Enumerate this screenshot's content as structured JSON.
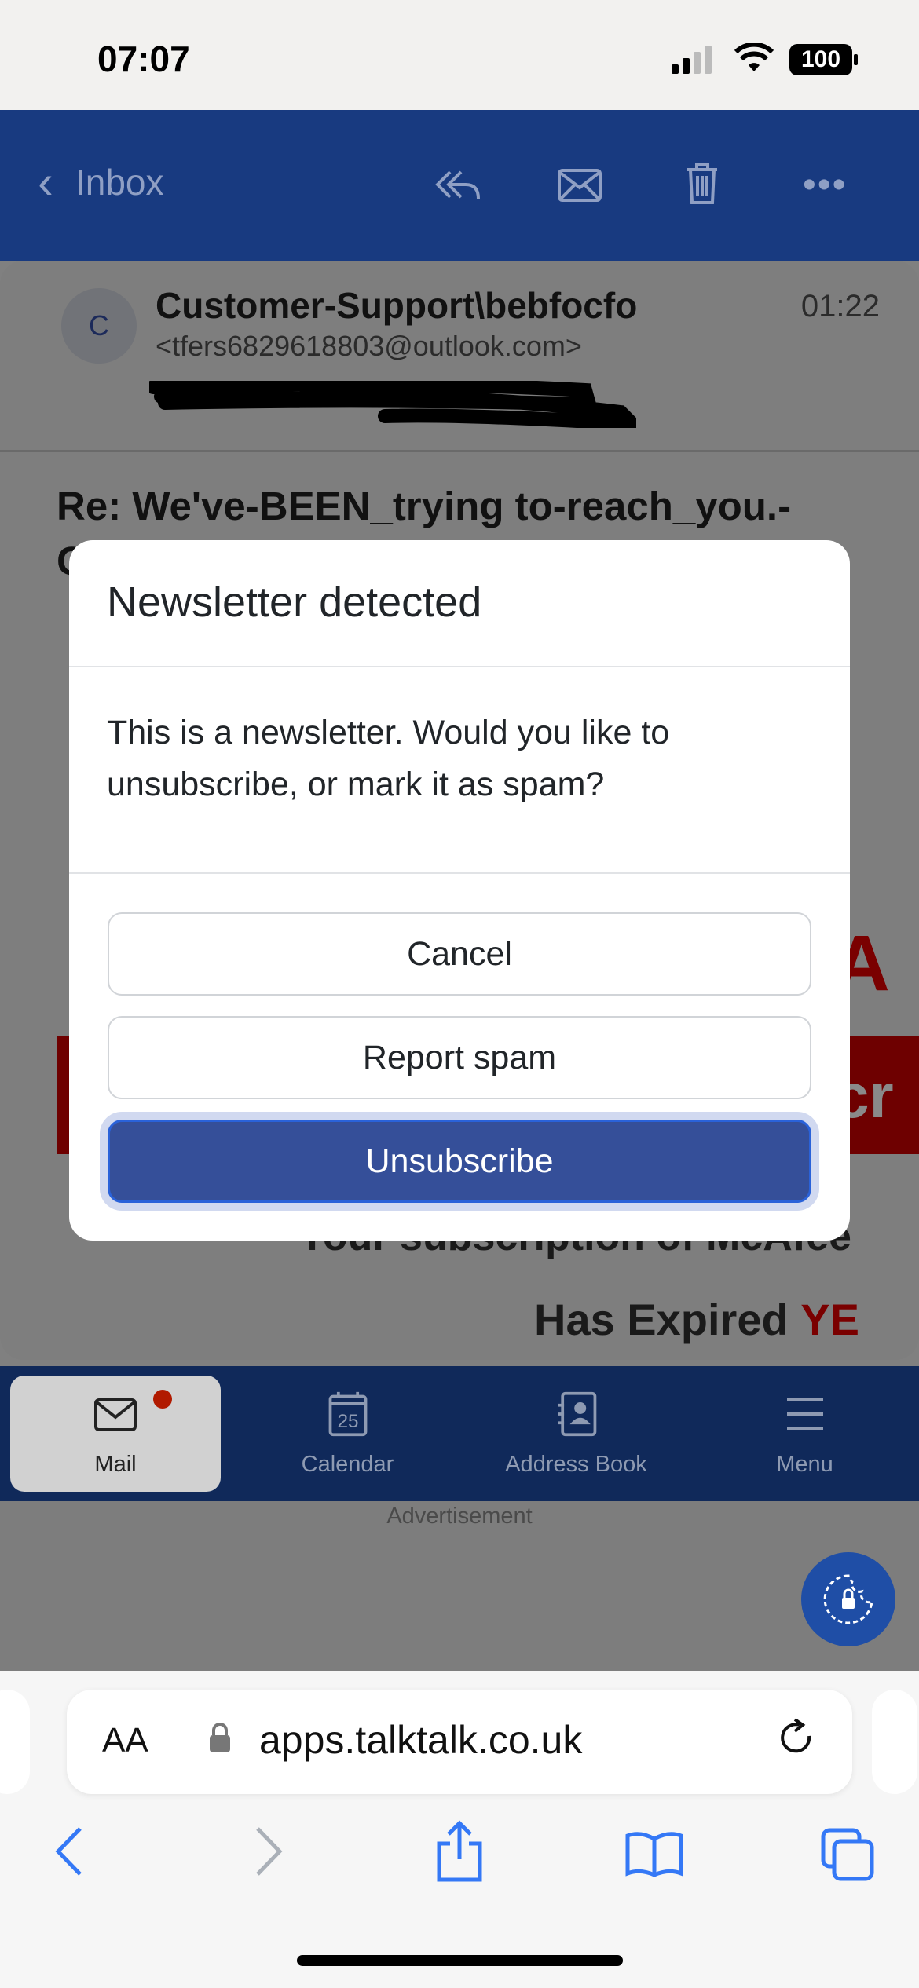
{
  "status_bar": {
    "time": "07:07",
    "battery": "100"
  },
  "header": {
    "back_label": "Inbox",
    "icons": [
      "reply-all-icon",
      "envelope-icon",
      "trash-icon",
      "more-icon"
    ]
  },
  "email": {
    "avatar_initial": "C",
    "sender_name": "Customer-Support\\bebfocfo",
    "sender_address": "<tfers6829618803@outlook.com>",
    "time": "01:22",
    "subject": "Re: We've-BEEN_trying to-reach_you.-",
    "subject_cont": "C",
    "body_line1": "Your subscription of McAfee",
    "body_line2_prefix": "Has Expired ",
    "body_line2_highlight": "YE",
    "body_partial_heading": "cA",
    "body_banner_partial": "cr"
  },
  "modal": {
    "title": "Newsletter detected",
    "message": "This is a newsletter. Would you like to unsubscribe, or mark it as spam?",
    "cancel_label": "Cancel",
    "report_label": "Report spam",
    "unsubscribe_label": "Unsubscribe",
    "accent": "#354f99"
  },
  "bottom_nav": {
    "items": [
      {
        "label": "Mail",
        "icon": "mail-icon",
        "active": true,
        "badge": true
      },
      {
        "label": "Calendar",
        "icon": "calendar-icon",
        "day": "25"
      },
      {
        "label": "Address Book",
        "icon": "address-book-icon"
      },
      {
        "label": "Menu",
        "icon": "menu-icon"
      }
    ]
  },
  "advertisement_label": "Advertisement",
  "browser": {
    "aa_label": "AA",
    "url": "apps.talktalk.co.uk",
    "accent": "#3478f6"
  }
}
